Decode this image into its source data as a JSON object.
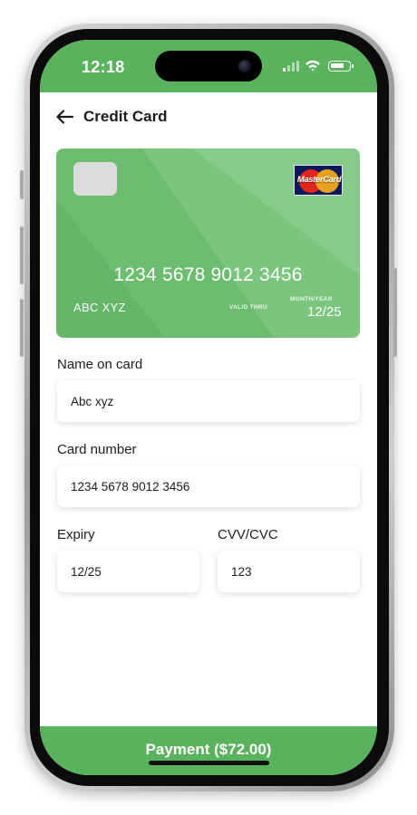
{
  "status_bar": {
    "time": "12:18"
  },
  "header": {
    "title": "Credit Card",
    "back_icon": "arrow-left-icon"
  },
  "card": {
    "brand": "MasterCard",
    "number": "1234 5678 9012 3456",
    "holder": "ABC XYZ",
    "valid_thru_label": "VALID THRU",
    "month_year_label": "MONTH/YEAR",
    "expiry": "12/25",
    "color": "#6cbd70"
  },
  "form": {
    "name": {
      "label": "Name on card",
      "value": "Abc xyz"
    },
    "number": {
      "label": "Card number",
      "value": "1234 5678 9012 3456"
    },
    "expiry": {
      "label": "Expiry",
      "value": "12/25"
    },
    "cvv": {
      "label": "CVV/CVC",
      "value": "123"
    }
  },
  "payment_button": {
    "label": "Payment ($72.00)"
  },
  "colors": {
    "accent": "#59b35d",
    "text": "#1d1d1d"
  }
}
